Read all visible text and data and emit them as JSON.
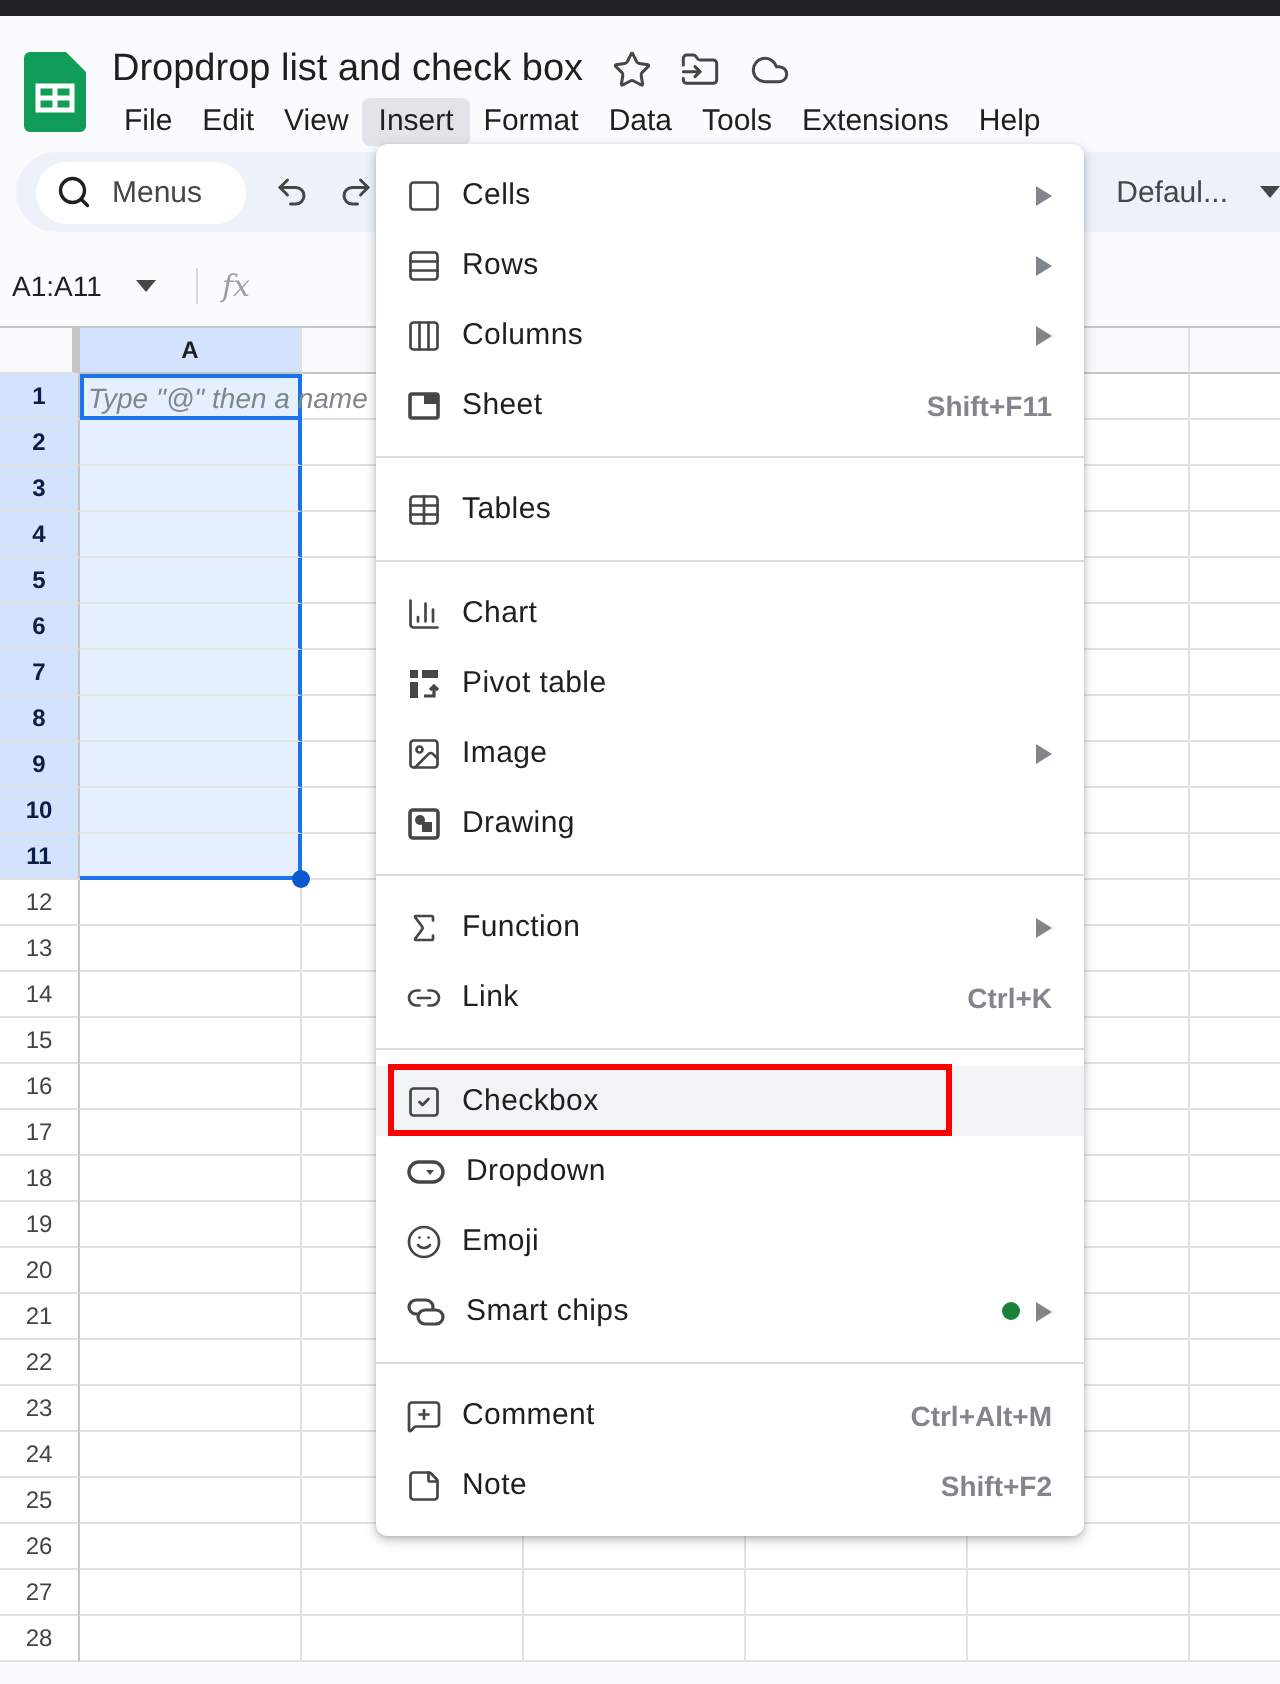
{
  "document": {
    "title": "Dropdrop list and check box"
  },
  "menu_bar": [
    {
      "label": "File",
      "selected": false
    },
    {
      "label": "Edit",
      "selected": false
    },
    {
      "label": "View",
      "selected": false
    },
    {
      "label": "Insert",
      "selected": true
    },
    {
      "label": "Format",
      "selected": false
    },
    {
      "label": "Data",
      "selected": false
    },
    {
      "label": "Tools",
      "selected": false
    },
    {
      "label": "Extensions",
      "selected": false
    },
    {
      "label": "Help",
      "selected": false
    }
  ],
  "toolbar": {
    "search": {
      "placeholder": "Menus"
    },
    "font": "Defaul..."
  },
  "formula_bar": {
    "name_box": "A1:A11",
    "fx": "fx"
  },
  "sheet": {
    "columns": [
      {
        "label": "A",
        "selected": true
      }
    ],
    "a1_hint": "Type \"@\" then a name",
    "rows": [
      {
        "label": "1",
        "selected": true
      },
      {
        "label": "2",
        "selected": true
      },
      {
        "label": "3",
        "selected": true
      },
      {
        "label": "4",
        "selected": true
      },
      {
        "label": "5",
        "selected": true
      },
      {
        "label": "6",
        "selected": true
      },
      {
        "label": "7",
        "selected": true
      },
      {
        "label": "8",
        "selected": true
      },
      {
        "label": "9",
        "selected": true
      },
      {
        "label": "10",
        "selected": true
      },
      {
        "label": "11",
        "selected": true
      },
      {
        "label": "12",
        "selected": false
      },
      {
        "label": "13",
        "selected": false
      },
      {
        "label": "14",
        "selected": false
      },
      {
        "label": "15",
        "selected": false
      },
      {
        "label": "16",
        "selected": false
      },
      {
        "label": "17",
        "selected": false
      },
      {
        "label": "18",
        "selected": false
      },
      {
        "label": "19",
        "selected": false
      },
      {
        "label": "20",
        "selected": false
      },
      {
        "label": "21",
        "selected": false
      },
      {
        "label": "22",
        "selected": false
      },
      {
        "label": "23",
        "selected": false
      },
      {
        "label": "24",
        "selected": false
      },
      {
        "label": "25",
        "selected": false
      },
      {
        "label": "26",
        "selected": false
      },
      {
        "label": "27",
        "selected": false
      },
      {
        "label": "28",
        "selected": false
      }
    ]
  },
  "insert_menu": {
    "groups": [
      [
        {
          "label": "Cells",
          "submenu": true,
          "selected": false,
          "annotated": false
        },
        {
          "label": "Rows",
          "submenu": true,
          "selected": false,
          "annotated": false
        },
        {
          "label": "Columns",
          "submenu": true,
          "selected": false,
          "annotated": false
        },
        {
          "label": "Sheet",
          "shortcut": "Shift+F11",
          "submenu": false,
          "selected": false,
          "annotated": false
        }
      ],
      [
        {
          "label": "Tables",
          "submenu": false,
          "selected": false,
          "annotated": false
        }
      ],
      [
        {
          "label": "Chart",
          "submenu": false,
          "selected": false,
          "annotated": false
        },
        {
          "label": "Pivot table",
          "submenu": false,
          "selected": false,
          "annotated": false
        },
        {
          "label": "Image",
          "submenu": true,
          "selected": false,
          "annotated": false
        },
        {
          "label": "Drawing",
          "submenu": false,
          "selected": false,
          "annotated": false
        }
      ],
      [
        {
          "label": "Function",
          "submenu": true,
          "selected": false,
          "annotated": false
        },
        {
          "label": "Link",
          "shortcut": "Ctrl+K",
          "submenu": false,
          "selected": false,
          "annotated": false
        }
      ],
      [
        {
          "label": "Checkbox",
          "submenu": false,
          "selected": true,
          "annotated": true
        },
        {
          "label": "Dropdown",
          "submenu": false,
          "selected": false,
          "annotated": false
        },
        {
          "label": "Emoji",
          "submenu": false,
          "selected": false,
          "annotated": false
        },
        {
          "label": "Smart chips",
          "submenu": true,
          "new_dot": true,
          "selected": false,
          "annotated": false
        }
      ],
      [
        {
          "label": "Comment",
          "shortcut": "Ctrl+Alt+M",
          "submenu": false,
          "selected": false,
          "annotated": false
        },
        {
          "label": "Note",
          "shortcut": "Shift+F2",
          "submenu": false,
          "selected": false,
          "annotated": false
        }
      ]
    ]
  }
}
